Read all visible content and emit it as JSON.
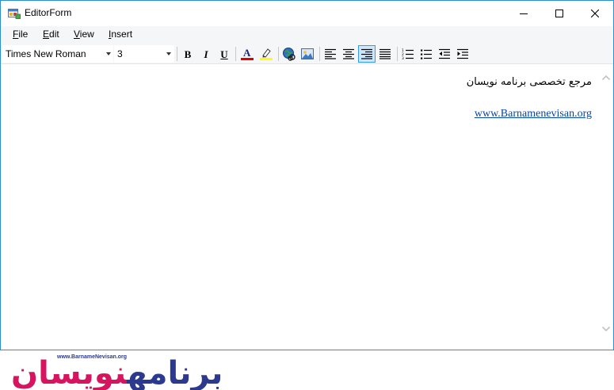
{
  "window": {
    "title": "EditorForm",
    "accent_color": "#2b8fd6"
  },
  "menu": {
    "items": [
      {
        "label": "File",
        "mnemonic": "F",
        "rest": "ile"
      },
      {
        "label": "Edit",
        "mnemonic": "E",
        "rest": "dit"
      },
      {
        "label": "View",
        "mnemonic": "V",
        "rest": "iew"
      },
      {
        "label": "Insert",
        "mnemonic": "I",
        "rest": "nsert"
      }
    ]
  },
  "toolbar": {
    "font_name": "Times New Roman",
    "font_size": "3",
    "bold_glyph": "B",
    "italic_glyph": "I",
    "underline_glyph": "U",
    "font_color_glyph": "A",
    "font_color": "#e00000",
    "highlight_color": "#ffff00",
    "active_alignment": "right"
  },
  "editor": {
    "line1": "مرجع تخصصی برنامه نویسان",
    "line2": "www.Barnamenevisan.org",
    "link_color": "#0645ad"
  },
  "footer": {
    "logo_url": "www.BarnameNevisan.org",
    "logo_text_part1": "برنامه",
    "logo_text_part2": "نویسان",
    "logo_color_1": "#2b3a8f",
    "logo_color_2": "#d6145f"
  }
}
